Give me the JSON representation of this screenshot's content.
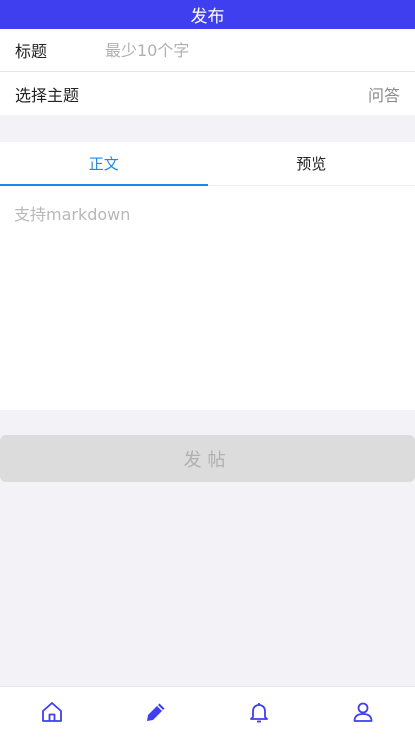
{
  "header": {
    "title": "发布"
  },
  "form": {
    "title_label": "标题",
    "title_placeholder": "最少10个字",
    "topic_label": "选择主题",
    "topic_value": "问答"
  },
  "editor": {
    "tabs": [
      "正文",
      "预览"
    ],
    "active_tab": 0,
    "placeholder": "支持markdown"
  },
  "submit": {
    "label": "发帖"
  },
  "bottom_nav": {
    "items": [
      {
        "icon": "home-icon"
      },
      {
        "icon": "pencil-icon",
        "active": true
      },
      {
        "icon": "bell-icon"
      },
      {
        "icon": "user-icon"
      }
    ]
  },
  "colors": {
    "header_bg": "#3f3fef",
    "tab_active": "#1e88e5",
    "nav_icon": "#3f3fef",
    "submit_bg": "#dcdcdc"
  }
}
